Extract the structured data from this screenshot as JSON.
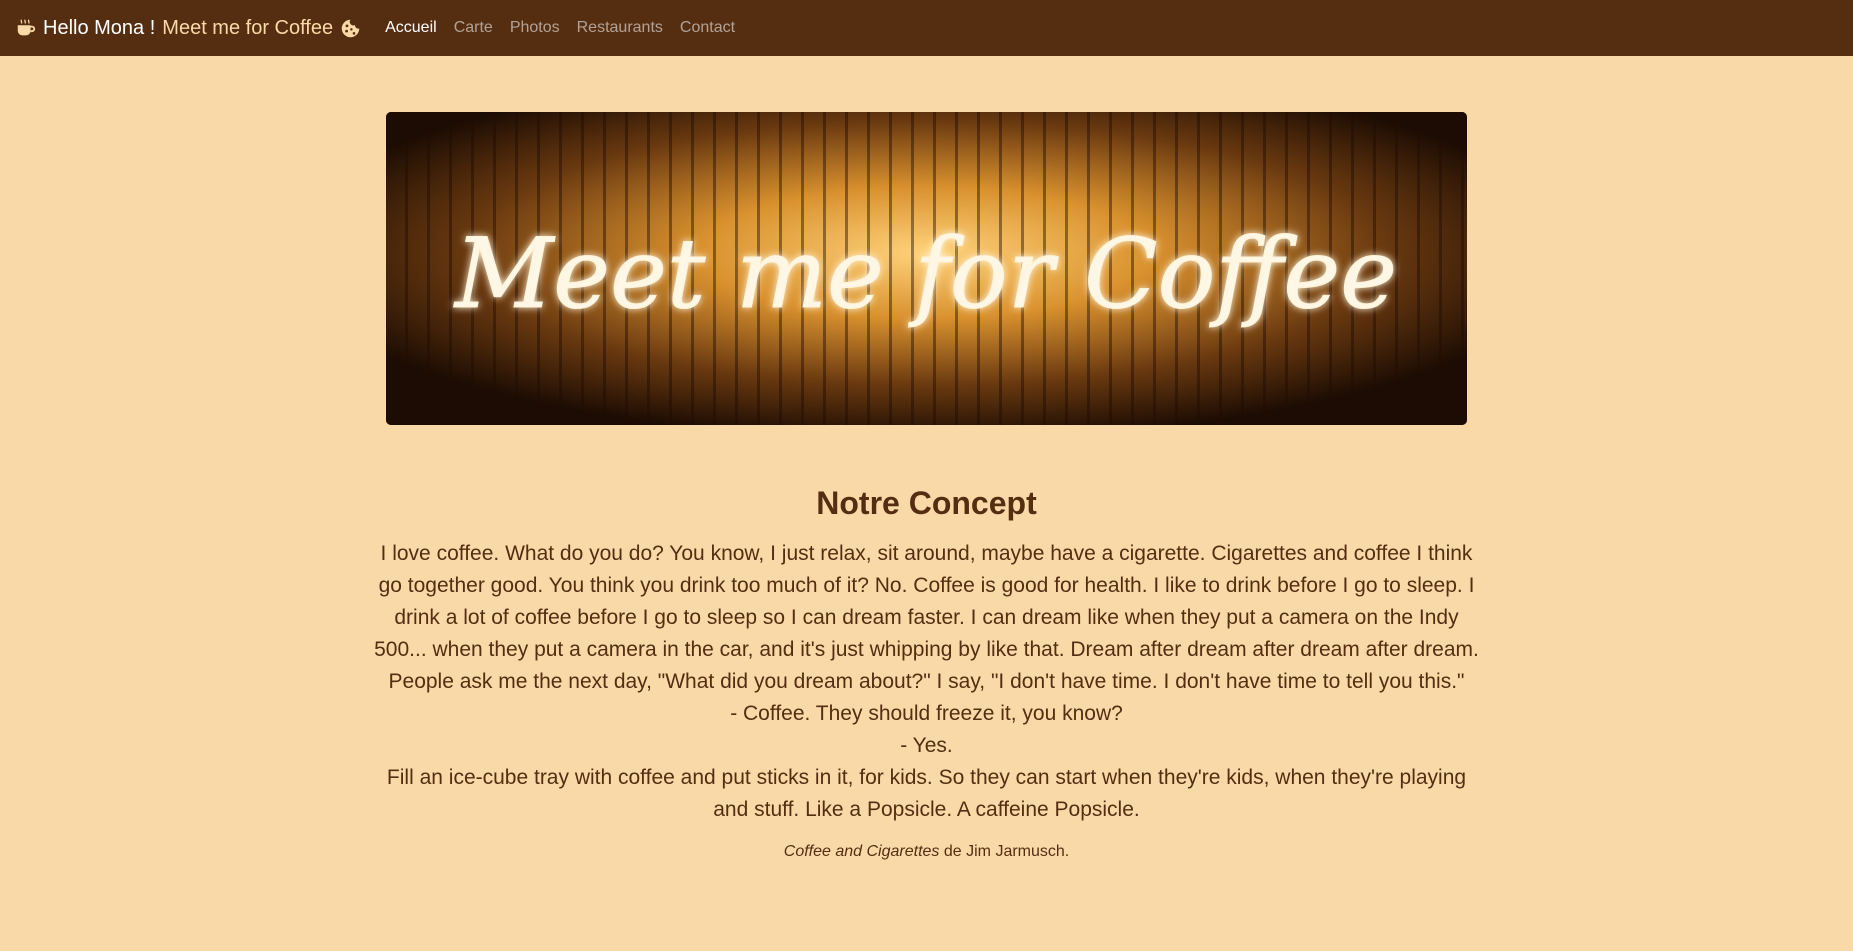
{
  "navbar": {
    "brand_hello": "Hello Mona !",
    "brand_tagline": "Meet me for Coffee",
    "links": [
      {
        "label": "Accueil",
        "active": true
      },
      {
        "label": "Carte",
        "active": false
      },
      {
        "label": "Photos",
        "active": false
      },
      {
        "label": "Restaurants",
        "active": false
      },
      {
        "label": "Contact",
        "active": false
      }
    ]
  },
  "hero": {
    "sign_text": "Meet me for Coffee"
  },
  "concept": {
    "title": "Notre Concept",
    "paragraphs": [
      "I love coffee. What do you do? You know, I just relax, sit around, maybe have a cigarette. Cigarettes and coffee I think go together good. You think you drink too much of it? No. Coffee is good for health. I like to drink before I go to sleep. I drink a lot of coffee before I go to sleep so I can dream faster. I can dream like when they put a camera on the Indy 500... when they put a camera in the car, and it's just whipping by like that. Dream after dream after dream after dream. People ask me the next day, \"What did you dream about?\" I say, \"I don't have time. I don't have time to tell you this.\"",
      "- Coffee. They should freeze it, you know?",
      "- Yes.",
      "Fill an ice-cube tray with coffee and put sticks in it, for kids. So they can start when they're kids, when they're playing and stuff. Like a Popsicle. A caffeine Popsicle."
    ],
    "credit_title": "Coffee and Cigarettes",
    "credit_rest": " de Jim Jarmusch."
  },
  "colors": {
    "navbar_bg": "#552e12",
    "page_bg": "#f9d9a8",
    "text": "#552e12"
  }
}
